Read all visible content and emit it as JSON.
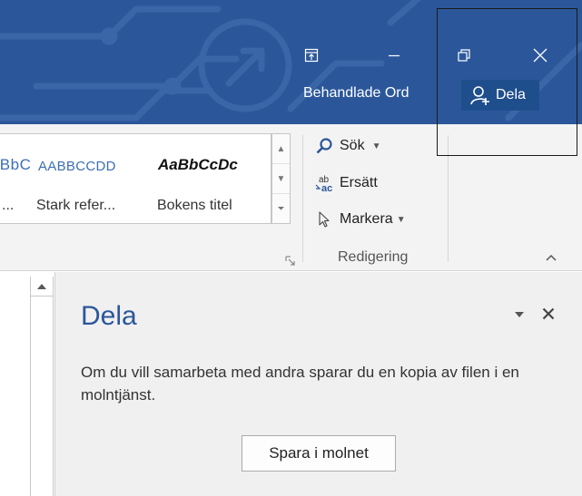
{
  "titlebar": {
    "document_title": "Behandlade Ord",
    "share_label": "Dela",
    "colors": {
      "background": "#2b579a",
      "share_button": "#1f4e8c"
    },
    "window_buttons": {
      "ribbon_display": "ribbon-display-options-icon",
      "minimize": "minimize-icon",
      "restore": "restore-icon",
      "close": "close-icon"
    }
  },
  "ribbon": {
    "styles": {
      "items": [
        {
          "sample": "AaBbCcDc",
          "caption": "..."
        },
        {
          "sample": "AABBCCDD",
          "caption": "Stark refer..."
        },
        {
          "sample": "AaBbCcDc",
          "caption": "Bokens titel"
        }
      ]
    },
    "editing": {
      "find_label": "Sök",
      "replace_label": "Ersätt",
      "select_label": "Markera",
      "group_label": "Redigering"
    }
  },
  "share_pane": {
    "title": "Dela",
    "message": "Om du vill samarbeta med andra sparar du en kopia av filen i en molntjänst.",
    "save_to_cloud_label": "Spara i molnet",
    "accent_color": "#2b579a"
  }
}
